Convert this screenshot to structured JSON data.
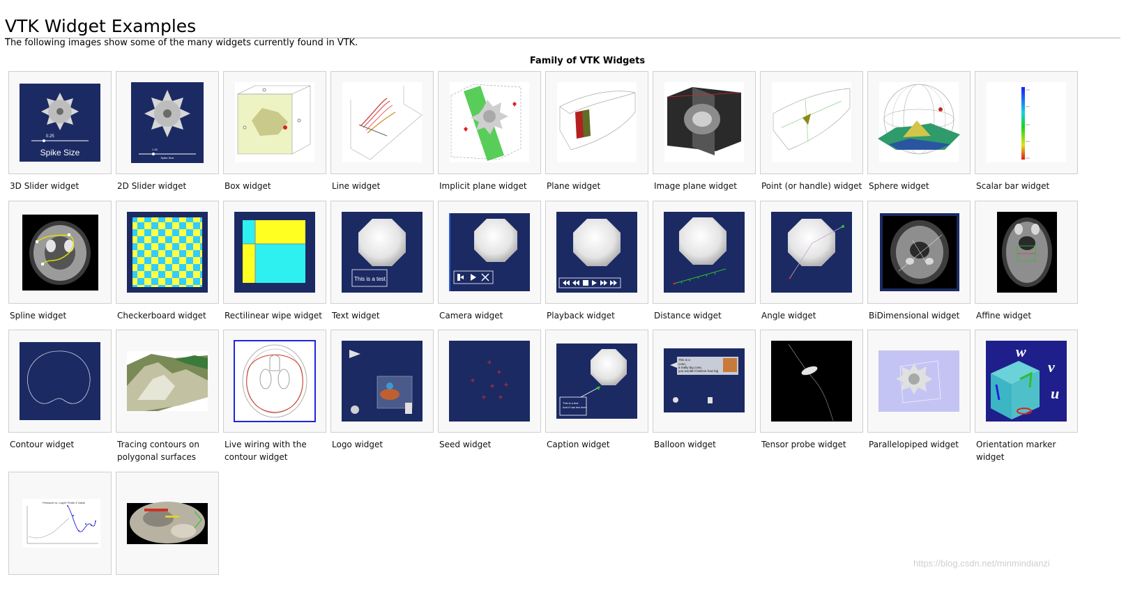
{
  "page": {
    "title": "VTK Widget Examples",
    "intro": "The following images show some of the many widgets currently found in VTK.",
    "caption": "Family of VTK Widgets"
  },
  "colors": {
    "navy": "#1b2a63",
    "border": "#cfcfcf",
    "thumb_bg": "#f8f8f8"
  },
  "widgets": [
    {
      "label": "3D Slider widget",
      "thumbnail": "navy-spiked-ball-slider",
      "text": [
        "0.25",
        "Spike Size"
      ]
    },
    {
      "label": "2D Slider widget",
      "thumbnail": "navy-spiked-ball-slider",
      "text": [
        "1.16",
        "Spike Size"
      ]
    },
    {
      "label": "Box widget",
      "thumbnail": "box-with-spiked-ball"
    },
    {
      "label": "Line widget",
      "thumbnail": "streamlines-in-box"
    },
    {
      "label": "Implicit plane widget",
      "thumbnail": "green-plane-spiked-ball"
    },
    {
      "label": "Plane widget",
      "thumbnail": "plane-in-outline"
    },
    {
      "label": "Image plane widget",
      "thumbnail": "ct-planes"
    },
    {
      "label": "Point (or handle) widget",
      "thumbnail": "point-in-outline"
    },
    {
      "label": "Sphere widget",
      "thumbnail": "wireframe-sphere-terrain"
    },
    {
      "label": "Scalar bar widget",
      "thumbnail": "scalar-bar"
    },
    {
      "label": "Spline widget",
      "thumbnail": "ct-head-spline"
    },
    {
      "label": "Checkerboard widget",
      "thumbnail": "checkerboard"
    },
    {
      "label": "Rectilinear wipe widget",
      "thumbnail": "rectilinear-wipe"
    },
    {
      "label": "Text widget",
      "thumbnail": "navy-octagon-text",
      "text": [
        "This is a test"
      ]
    },
    {
      "label": "Camera widget",
      "thumbnail": "navy-octagon-camera"
    },
    {
      "label": "Playback widget",
      "thumbnail": "navy-octagon-playback"
    },
    {
      "label": "Distance widget",
      "thumbnail": "navy-octagon-distance"
    },
    {
      "label": "Angle widget",
      "thumbnail": "navy-octagon-angle"
    },
    {
      "label": "BiDimensional widget",
      "thumbnail": "ct-bidimensional"
    },
    {
      "label": "Affine widget",
      "thumbnail": "ct-affine"
    },
    {
      "label": "Contour widget",
      "thumbnail": "navy-contour"
    },
    {
      "label": "Tracing contours on polygonal surfaces",
      "thumbnail": "terrain-surface"
    },
    {
      "label": "Live wiring with the contour widget",
      "thumbnail": "live-wire-ct"
    },
    {
      "label": "Logo widget",
      "thumbnail": "navy-logo"
    },
    {
      "label": "Seed widget",
      "thumbnail": "navy-seeds"
    },
    {
      "label": "Caption widget",
      "thumbnail": "navy-octagon-caption",
      "text": [
        "This is a test",
        "And it has two lines"
      ]
    },
    {
      "label": "Balloon widget",
      "thumbnail": "navy-balloon",
      "text": [
        "This is a",
        "cone,",
        "a really big cone,",
        "you wouldn't believe how big"
      ]
    },
    {
      "label": "Tensor probe widget",
      "thumbnail": "tensor-probe"
    },
    {
      "label": "Parallelopiped widget",
      "thumbnail": "parallelopiped"
    },
    {
      "label": "Orientation marker widget",
      "thumbnail": "orientation-cube",
      "text": [
        "w",
        "v",
        "u"
      ]
    },
    {
      "label": "",
      "thumbnail": "xy-plot",
      "text": [
        "Pressure vs. Log10 Probe Z Value"
      ]
    },
    {
      "label": "",
      "thumbnail": "sphere-texture"
    }
  ],
  "watermark": "https://blog.csdn.net/minmindianzi"
}
